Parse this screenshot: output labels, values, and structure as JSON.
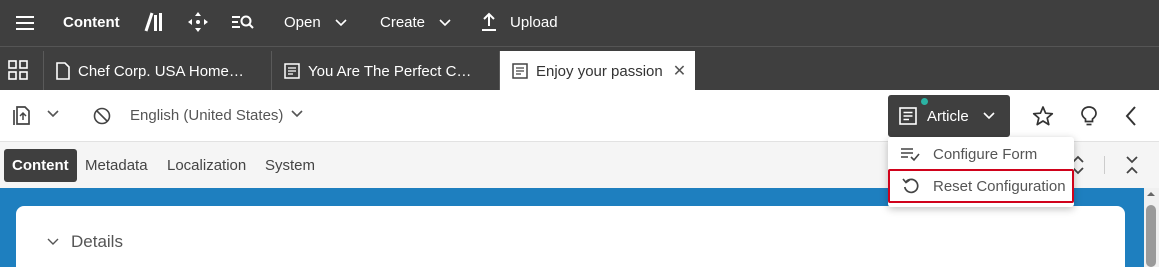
{
  "topbar": {
    "app_title": "Content",
    "open_label": "Open",
    "create_label": "Create",
    "upload_label": "Upload"
  },
  "tabs": [
    {
      "label": "Chef Corp. USA Home…",
      "active": false
    },
    {
      "label": "You Are The Perfect C…",
      "active": false
    },
    {
      "label": "Enjoy your passion",
      "active": true
    }
  ],
  "subbar": {
    "language": "English (United States)",
    "article_label": "Article"
  },
  "form_tabs": [
    "Content",
    "Metadata",
    "Localization",
    "System"
  ],
  "dropdown": {
    "items": [
      {
        "label": "Configure Form",
        "icon": "configure-form-icon"
      },
      {
        "label": "Reset Configuration",
        "icon": "reset-icon"
      }
    ]
  },
  "panel": {
    "section_title": "Details"
  },
  "colors": {
    "toolbar_bg": "#3f3f3f",
    "content_bg": "#1e7fbf",
    "status_dot": "#2bb3a3",
    "highlight": "#d0021b"
  }
}
